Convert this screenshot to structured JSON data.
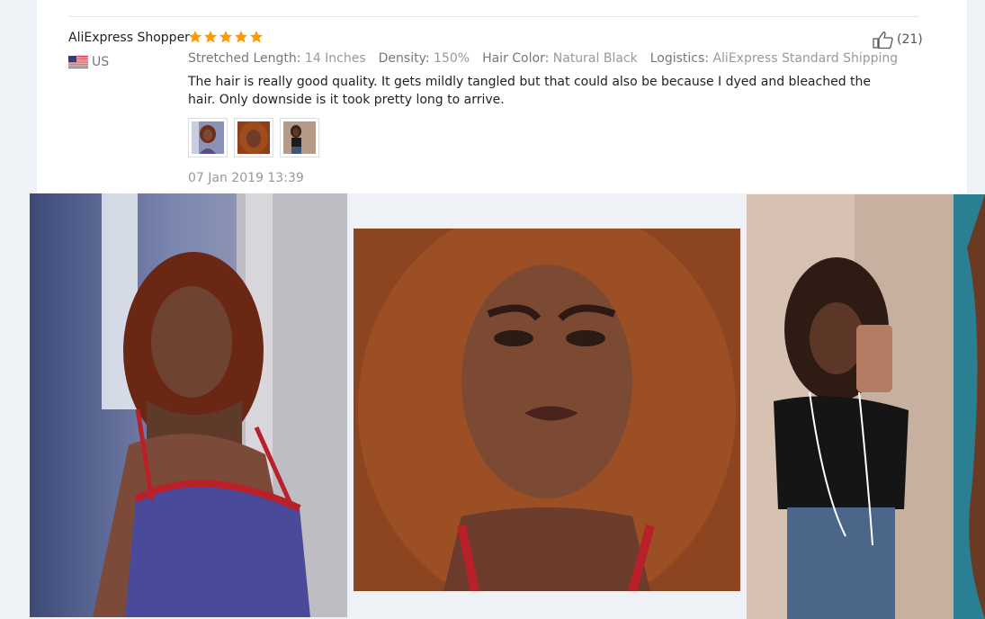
{
  "review": {
    "reviewer_name": "AliExpress Shopper",
    "rating_stars": 5,
    "country_code": "US",
    "attributes": {
      "stretched_length_label": "Stretched Length:",
      "stretched_length_value": "14 Inches",
      "density_label": "Density:",
      "density_value": "150%",
      "hair_color_label": "Hair Color:",
      "hair_color_value": "Natural Black",
      "logistics_label": "Logistics:",
      "logistics_value": "AliExpress Standard Shipping"
    },
    "text": "The hair is really good quality. It gets mildly tangled but that could also be because I dyed and bleached the hair. Only downside is it took pretty long to arrive.",
    "date": "07 Jan 2019 13:39",
    "like_count": "(21)",
    "thumbnail_count": 3
  },
  "icons": {
    "star": "star-icon",
    "flag": "us-flag-icon",
    "like": "thumbs-up-icon"
  },
  "colors": {
    "star": "#ff9900",
    "card_background": "#ffffff",
    "page_background": "#eef1f6"
  }
}
